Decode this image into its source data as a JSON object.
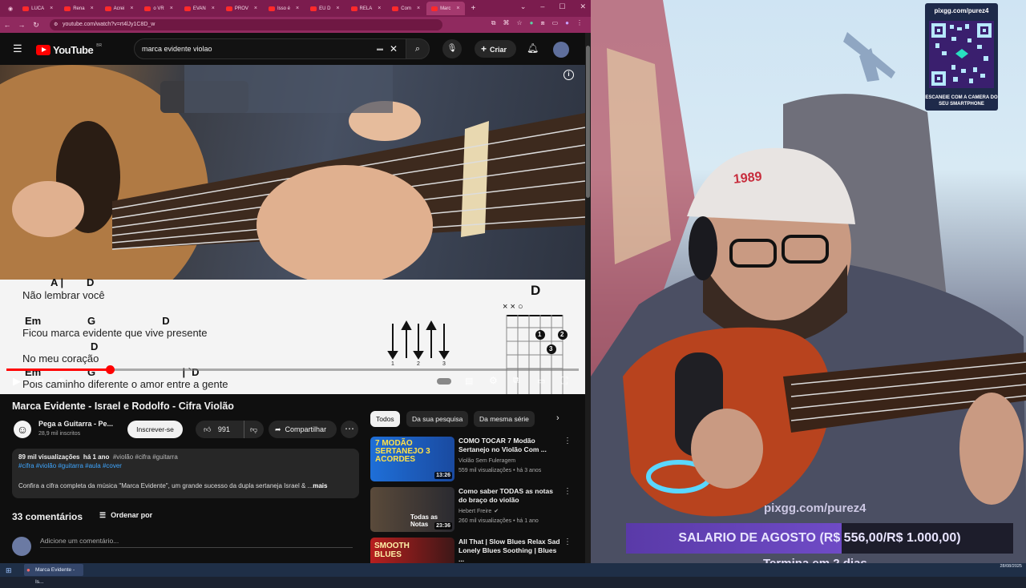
{
  "browser": {
    "tabs": [
      {
        "label": "LUCA"
      },
      {
        "label": "Rena"
      },
      {
        "label": "Acrei"
      },
      {
        "label": "o VR"
      },
      {
        "label": "EVAN"
      },
      {
        "label": "PROV"
      },
      {
        "label": "Isso é"
      },
      {
        "label": "EU D"
      },
      {
        "label": "RELA"
      },
      {
        "label": "Com"
      },
      {
        "label": "Marc"
      }
    ],
    "new_tab": "+",
    "url": "youtube.com/watch?v=rt4lJy1C8D_w"
  },
  "youtube": {
    "logo_text": "YouTube",
    "logo_region": "BR",
    "search_value": "marca evidente violao",
    "create_label": "Criar",
    "video": {
      "lyrics": [
        {
          "chords": "A |        D",
          "line": "Não lembrar você"
        },
        {
          "chords": "Em                G                       D",
          "line": "Ficou marca evidente que vive presente"
        },
        {
          "chords": "D",
          "line": "No meu coração"
        },
        {
          "chords": "Em                G                              | `D",
          "line": "Pois caminho diferente o amor entre a gente"
        }
      ],
      "chord_name": "D",
      "chord_mutes": "× × ○",
      "finger_labels": [
        "1",
        "2",
        "3"
      ],
      "strum_labels": [
        "1",
        "2",
        "3"
      ],
      "progress": 0.18
    },
    "title": "Marca Evidente - Israel e Rodolfo - Cifra Violão",
    "channel": {
      "name": "Pega a Guitarra - Pe...",
      "subs": "28,9 mil inscritos",
      "subscribe": "Inscrever-se"
    },
    "likes": "991",
    "share": "Compartilhar",
    "description": {
      "meta": "89 mil visualizações  há 1 ano  ",
      "hashtags1": "#violão #cifra #guitarra",
      "hashtags2": "#cifra #violão #guitarra #aula #cover",
      "text": "Confira a cifra completa da música \"Marca Evidente\", um grande sucesso da dupla sertaneja Israel & ...",
      "more": "mais"
    },
    "comments_count": "33 comentários",
    "sort_label": "Ordenar por",
    "comment_placeholder": "Adicione um comentário...",
    "chips": [
      "Todos",
      "Da sua pesquisa",
      "Da mesma série"
    ],
    "related": [
      {
        "title": "COMO TOCAR 7 Modão Sertanejo no Violão Com ...",
        "channel": "Violão Sem Fuleragem",
        "meta": "559 mil visualizações • há 3 anos",
        "duration": "13:26",
        "thumb_text": "7 MODÃO SERTANEJO 3 ACORDES"
      },
      {
        "title": "Como saber TODAS as notas do braço do violão",
        "channel": "Hebert Freire",
        "meta": "260 mil visualizações • há 1 ano",
        "duration": "23:36",
        "thumb_text": "Todas as Notas"
      },
      {
        "title": "All That | Slow Blues Relax Sad Lonely Blues Soothing | Blues ...",
        "channel": "",
        "meta": "",
        "duration": "",
        "thumb_text": "SMOOTH BLUES"
      }
    ]
  },
  "stream": {
    "qr_title": "pixgg.com/purez4",
    "qr_caption": "ESCANEIE COM A CAMERA DO SEU SMARTPHONE",
    "pix_url": "pixgg.com/purez4",
    "cap_logo": "1989",
    "goal_text": "SALARIO DE AGOSTO (R$ 556,00/R$ 1.000,00)",
    "goal_fraction": 0.556,
    "goal_ends": "Termina em 2 dias"
  },
  "taskbar": {
    "item_label": "Marca Evidente - Is...",
    "date": "28/08/2025"
  }
}
